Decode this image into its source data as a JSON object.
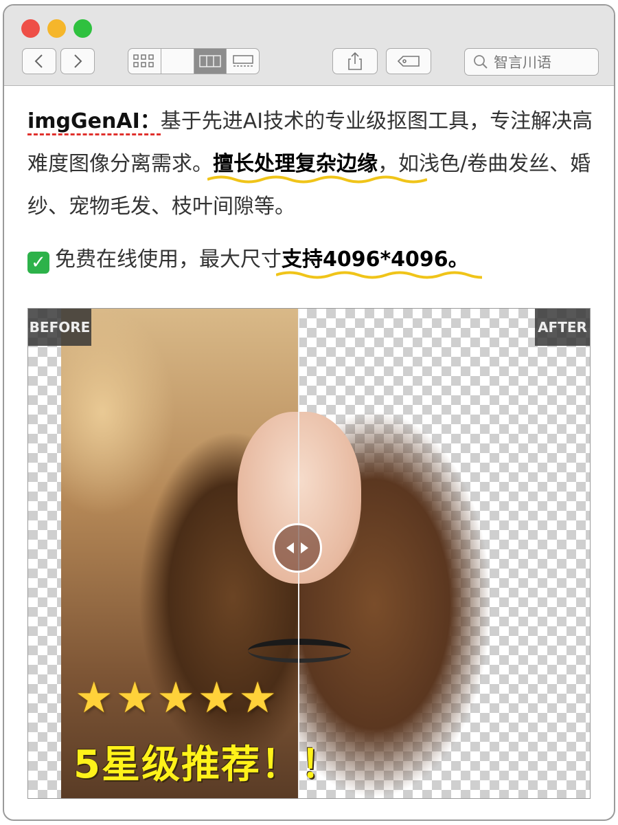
{
  "window": {
    "search_placeholder": "智言川语"
  },
  "intro": {
    "brand": "imgGenAI：",
    "text1": "基于先进AI技术的专业级抠图工具，专注解决高难度图像分离需求。",
    "highlight1": "擅长处理复杂边缘",
    "text2": "，如浅色/卷曲发丝、婚纱、宠物毛发、枝叶间隙等。"
  },
  "feature": {
    "text": "免费在线使用，最大尺寸",
    "highlight": "支持4096*4096。"
  },
  "comparison": {
    "before_label": "BEFORE",
    "after_label": "AFTER",
    "rating_stars": 5,
    "star_glyph": "★",
    "recommend_text": "5星级推荐！！"
  },
  "colors": {
    "accent_red": "#e0312d",
    "wave_yellow": "#f0c419",
    "check_green": "#2db24a"
  }
}
